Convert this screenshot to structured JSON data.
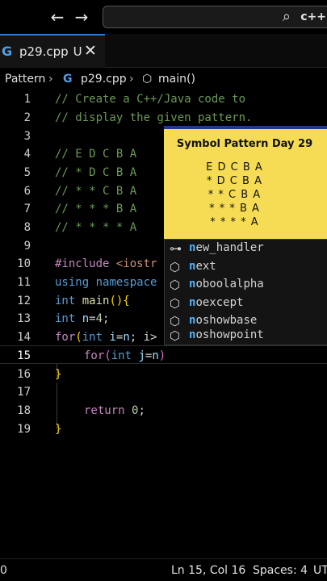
{
  "search": {
    "text": "c++"
  },
  "tab": {
    "filename": "p29.cpp",
    "modified": "U"
  },
  "breadcrumb": {
    "folder": "Pattern",
    "file": "p29.cpp",
    "symbol": "main()"
  },
  "editor": {
    "line_numbers": [
      "1",
      "2",
      "3",
      "4",
      "5",
      "6",
      "7",
      "8",
      "9",
      "10",
      "11",
      "12",
      "13",
      "14",
      "15",
      "16",
      "17",
      "18",
      "19"
    ],
    "lines": {
      "l1": "// Create a C++/Java code to",
      "l2": "// display the given pattern.",
      "l4": "// E D C B A",
      "l5": "// * D C B A",
      "l6": "// * * C B A",
      "l7": "// * * * B A",
      "l8": "// * * * * A",
      "l10_a": "#include",
      "l10_b": " <iostr",
      "l11_a": "using",
      "l11_b": " namespace",
      "l12_a": "int",
      "l12_b": " main",
      "l12_c": "(){",
      "l13_a": "int",
      "l13_b": " n",
      "l13_c": "=",
      "l13_d": "4",
      "l13_e": ";",
      "l14_a": "for",
      "l14_b": "(",
      "l14_c": "int",
      "l14_d": " i",
      "l14_e": "=",
      "l14_f": "n",
      "l14_g": "; i>",
      "l15_a": "for",
      "l15_b": "(",
      "l15_c": "int",
      "l15_d": " j",
      "l15_e": "=",
      "l15_f": "n",
      "l15_g": ")",
      "l16": "}",
      "l18_a": "return",
      "l18_b": " 0",
      "l18_c": ";",
      "l19": "}"
    }
  },
  "card": {
    "title": "Symbol Pattern Day 29",
    "rows": [
      "E D C B A",
      "* D C B A",
      "* * C B A",
      "* * * B A",
      "* * * * A"
    ]
  },
  "suggestions": [
    {
      "match": "n",
      "rest": "ew_handler",
      "icon": "class-icon"
    },
    {
      "match": "n",
      "rest": "ext",
      "icon": "cube-icon"
    },
    {
      "match": "n",
      "rest": "oboolalpha",
      "icon": "cube-icon"
    },
    {
      "match": "n",
      "rest": "oexcept",
      "icon": "cube-icon"
    },
    {
      "match": "n",
      "rest": "oshowbase",
      "icon": "cube-icon"
    },
    {
      "match": "n",
      "rest": "oshowpoint",
      "icon": "cube-icon"
    }
  ],
  "status": {
    "left": "0",
    "position": "Ln 15, Col 16",
    "spaces": "Spaces: 4",
    "encoding": "UT"
  }
}
